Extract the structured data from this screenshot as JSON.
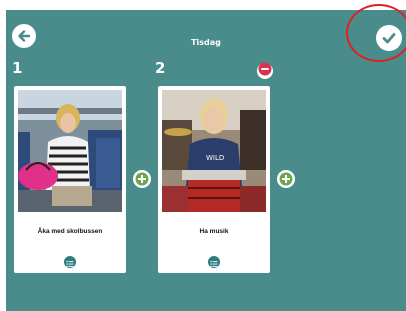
{
  "header": {
    "title": "Tisdag"
  },
  "steps": [
    {
      "number": "1",
      "label": "Åka med skolbussen"
    },
    {
      "number": "2",
      "label": "Ha musik"
    }
  ],
  "icons": {
    "back": "arrow-left-icon",
    "done": "checkmark-icon",
    "add": "plus-icon",
    "remove": "minus-icon",
    "list": "list-icon"
  },
  "colors": {
    "background": "#4a8b8c",
    "accent_green": "#6aa84f",
    "remove_red": "#d9334f",
    "list_button": "#2f7c7e",
    "highlight_ring": "#e02020"
  }
}
